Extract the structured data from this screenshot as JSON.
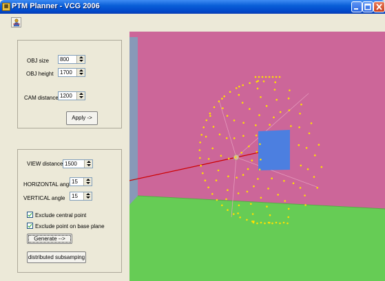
{
  "window": {
    "title": "PTM Planner - VCG 2006",
    "app_icon": "app-icon"
  },
  "toolbar": {
    "icons": [
      "toolbar-person-icon"
    ]
  },
  "object_group": {
    "obj_size_label": "OBJ size",
    "obj_size_value": "800",
    "obj_height_label": "OBJ height",
    "obj_height_value": "1700",
    "cam_distance_label": "CAM distance",
    "cam_distance_value": "1200",
    "apply_label": "Apply ->"
  },
  "view_group": {
    "view_distance_label": "VIEW distance",
    "view_distance_value": "1500",
    "horizontal_angle_label": "HORIZONTAL angle",
    "horizontal_angle_value": "15",
    "vertical_angle_label": "VERTICAL angle",
    "vertical_angle_value": "15",
    "exclude_central_label": "Exclude central point",
    "exclude_central_checked": true,
    "exclude_base_label": "Exclude point on base plane",
    "exclude_base_checked": true,
    "generate_label": "Generate -->",
    "subsampling_label": "distributed subsamping"
  },
  "viewport": {
    "wall_color": "#cc6699",
    "side_wall_color": "#8899b8",
    "floor_color": "#66cc55",
    "object_color": "#4c7fe0",
    "point_color": "#ffe000",
    "x_axis_color": "#cc0000"
  }
}
